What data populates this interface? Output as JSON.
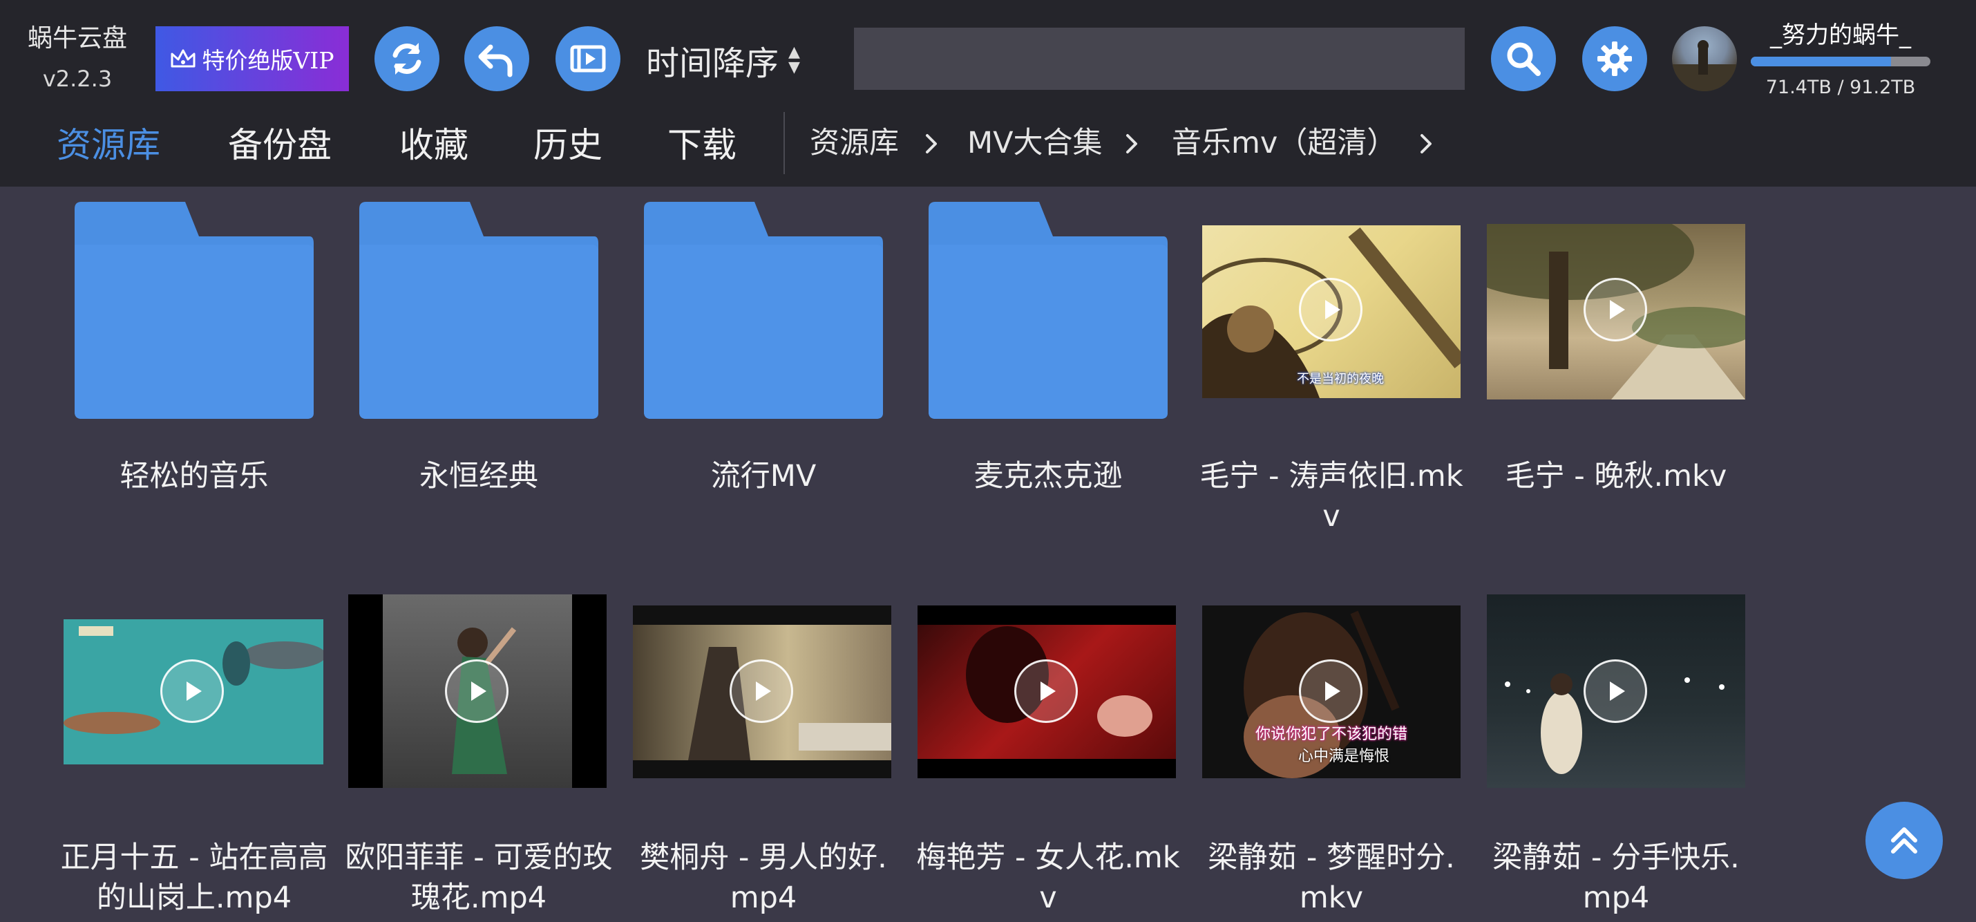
{
  "app": {
    "name": "蜗牛云盘",
    "version": "v2.2.3"
  },
  "header": {
    "vip_label": "特价绝版VIP",
    "sort_label": "时间降序",
    "search_value": "",
    "user": {
      "name": "_努力的蜗牛_",
      "quota": "71.4TB / 91.2TB",
      "used_fraction": 0.78
    }
  },
  "tabs": [
    {
      "label": "资源库",
      "active": true
    },
    {
      "label": "备份盘",
      "active": false
    },
    {
      "label": "收藏",
      "active": false
    },
    {
      "label": "历史",
      "active": false
    },
    {
      "label": "下载",
      "active": false
    }
  ],
  "breadcrumb": [
    "资源库",
    "MV大合集",
    "音乐mv（超清）"
  ],
  "items": [
    {
      "type": "folder",
      "name": "轻松的音乐"
    },
    {
      "type": "folder",
      "name": "永恒经典"
    },
    {
      "type": "folder",
      "name": "流行MV"
    },
    {
      "type": "folder",
      "name": "麦克杰克逊"
    },
    {
      "type": "video",
      "name": "毛宁 - 涛声依旧.mkv",
      "subtitle": "不是当初的夜晚"
    },
    {
      "type": "video",
      "name": "毛宁 - 晚秋.mkv"
    },
    {
      "type": "video",
      "name": "正月十五 - 站在高高的山岗上.mp4"
    },
    {
      "type": "video",
      "name": "欧阳菲菲 - 可爱的玫瑰花.mp4"
    },
    {
      "type": "video",
      "name": "樊桐舟 - 男人的好.mp4"
    },
    {
      "type": "video",
      "name": "梅艳芳 - 女人花.mkv"
    },
    {
      "type": "video",
      "name": "梁静茹 - 梦醒时分.mkv",
      "subtitle": "你说你犯了不该犯的错",
      "subtitle2": "心中满是悔恨"
    },
    {
      "type": "video",
      "name": "梁静茹 - 分手快乐.mp4"
    }
  ],
  "colors": {
    "accent": "#4b8fe3",
    "background": "#3b3948",
    "topbar": "#25252b",
    "folder": "#4b8fe3"
  },
  "icons": [
    "vip-crown-icon",
    "refresh-icon",
    "back-icon",
    "video-list-icon",
    "sort-icon",
    "search-icon",
    "settings-icon",
    "chevron-right-icon",
    "play-icon",
    "scroll-top-icon"
  ]
}
